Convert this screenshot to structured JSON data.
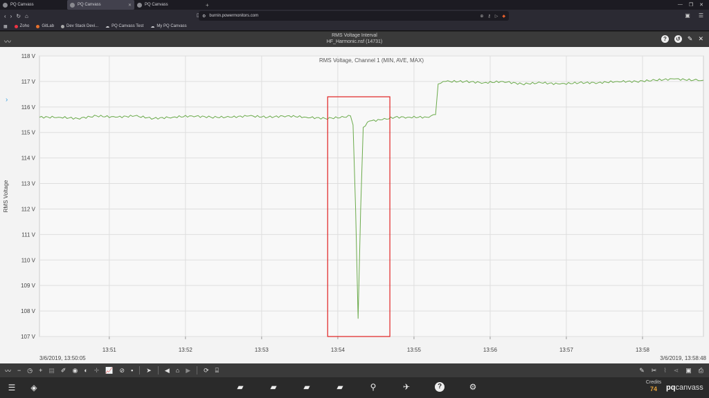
{
  "browser": {
    "tabs": [
      {
        "label": "PQ Canvass",
        "active": false
      },
      {
        "label": "PQ Canvass",
        "active": true
      },
      {
        "label": "PQ Canvass",
        "active": false
      }
    ],
    "url": "burnin.powermonitors.com",
    "bookmarks": [
      "Zoho",
      "GitLab",
      "Dev Stack Devi...",
      "PQ Canvass Test",
      "My PQ Canvass"
    ]
  },
  "header": {
    "title": "RMS Voltage Interval",
    "subtitle": "HF_Harmonic.nsf (14731)"
  },
  "chart_data": {
    "type": "line",
    "title": "RMS Voltage, Channel 1 (MIN, AVE, MAX)",
    "ylabel": "RMS Voltage",
    "ylim": [
      107,
      118
    ],
    "yticks": [
      "107 V",
      "108 V",
      "109 V",
      "110 V",
      "111 V",
      "112 V",
      "113 V",
      "114 V",
      "115 V",
      "116 V",
      "117 V",
      "118 V"
    ],
    "xticks": [
      "13:51",
      "13:52",
      "13:53",
      "13:54",
      "13:55",
      "13:56",
      "13:57",
      "13:58"
    ],
    "x_start_label": "3/6/2019, 13:50:05",
    "x_end_label": "3/6/2019, 13:58:48",
    "series_color": "#6aaa4a",
    "highlight_color": "#e02020",
    "series": [
      {
        "points": [
          [
            "13:50:05",
            115.6
          ],
          [
            "13:50:20",
            115.6
          ],
          [
            "13:50:35",
            115.55
          ],
          [
            "13:50:50",
            115.65
          ],
          [
            "13:51:05",
            115.6
          ],
          [
            "13:51:20",
            115.65
          ],
          [
            "13:51:35",
            115.55
          ],
          [
            "13:51:50",
            115.6
          ],
          [
            "13:52:05",
            115.65
          ],
          [
            "13:52:20",
            115.6
          ],
          [
            "13:52:35",
            115.6
          ],
          [
            "13:52:50",
            115.65
          ],
          [
            "13:53:05",
            115.6
          ],
          [
            "13:53:20",
            115.65
          ],
          [
            "13:53:35",
            115.6
          ],
          [
            "13:53:50",
            115.55
          ],
          [
            "13:54:05",
            115.6
          ],
          [
            "13:54:10",
            115.65
          ],
          [
            "13:54:12",
            115.3
          ],
          [
            "13:54:14",
            112.0
          ],
          [
            "13:54:16",
            107.7
          ],
          [
            "13:54:18",
            112.0
          ],
          [
            "13:54:20",
            115.2
          ],
          [
            "13:54:25",
            115.45
          ],
          [
            "13:54:35",
            115.5
          ],
          [
            "13:54:45",
            115.6
          ],
          [
            "13:54:55",
            115.6
          ],
          [
            "13:55:10",
            115.6
          ],
          [
            "13:55:17",
            115.7
          ],
          [
            "13:55:19",
            116.9
          ],
          [
            "13:55:25",
            117.0
          ],
          [
            "13:55:40",
            117.0
          ],
          [
            "13:55:55",
            116.95
          ],
          [
            "13:56:10",
            117.0
          ],
          [
            "13:56:25",
            116.9
          ],
          [
            "13:56:40",
            116.95
          ],
          [
            "13:56:55",
            116.9
          ],
          [
            "13:57:10",
            116.95
          ],
          [
            "13:57:25",
            116.95
          ],
          [
            "13:57:40",
            117.0
          ],
          [
            "13:57:55",
            117.0
          ],
          [
            "13:58:10",
            117.05
          ],
          [
            "13:58:25",
            117.1
          ],
          [
            "13:58:40",
            117.05
          ],
          [
            "13:58:48",
            117.05
          ]
        ]
      }
    ],
    "highlight": {
      "x_from": "13:53:52",
      "x_to": "13:54:41",
      "y_from": 107,
      "y_to": 116.4
    }
  },
  "toolbar": {},
  "footer": {
    "credits_label": "Credits",
    "credits_value": "74",
    "brand_bold": "pq",
    "brand_light": "canvass"
  }
}
